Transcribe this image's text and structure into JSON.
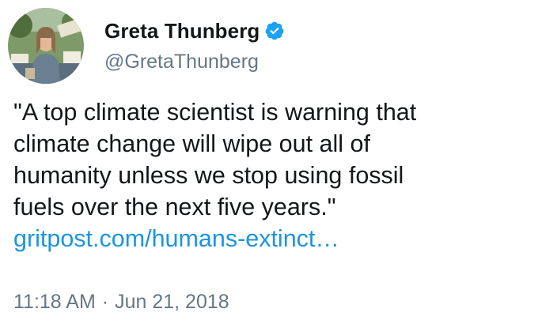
{
  "user": {
    "display_name": "Greta Thunberg",
    "handle": "@GretaThunberg",
    "verified": true,
    "avatar_icon": "profile-photo"
  },
  "tweet": {
    "text_lines": [
      "\"A top climate scientist is warning that",
      "climate change will wipe out all of",
      "humanity unless we stop using fossil",
      "fuels over the next five years.\""
    ],
    "link_text": "gritpost.com/humans-extinct…",
    "time": "11:18 AM",
    "separator": "·",
    "date": "Jun 21, 2018"
  },
  "colors": {
    "text": "#14171a",
    "secondary": "#657786",
    "link": "#1b95e0",
    "verified_badge": "#1da1f2"
  }
}
